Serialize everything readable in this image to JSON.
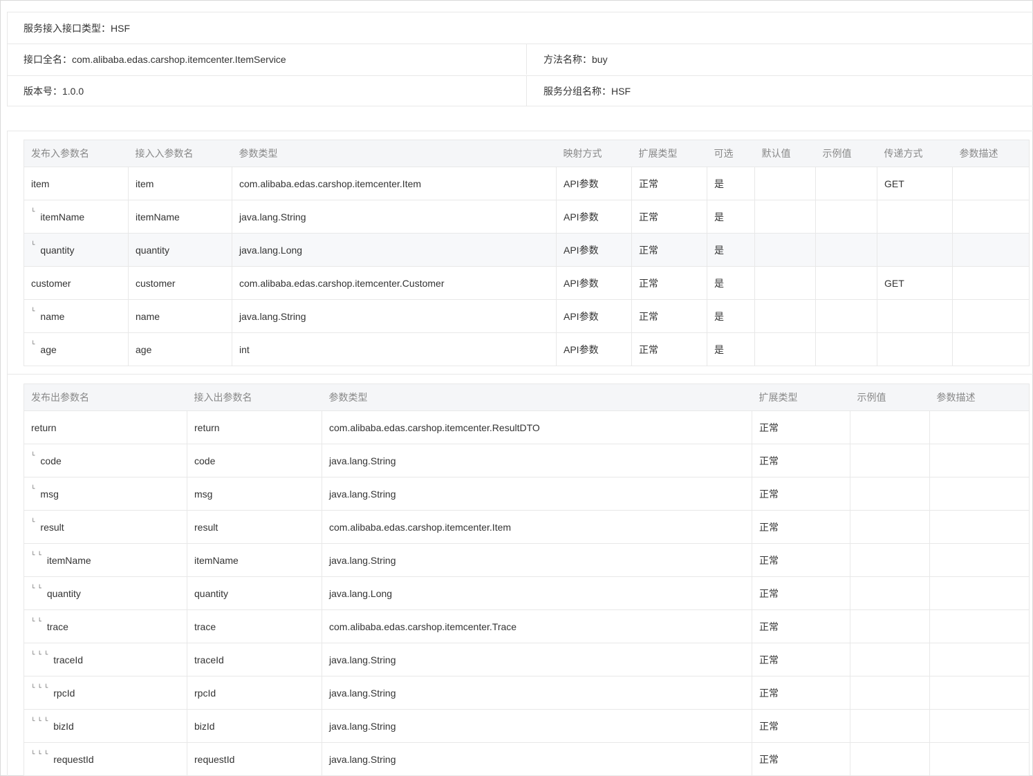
{
  "info": {
    "interface_type_label": "服务接入接口类型：",
    "interface_type_value": "HSF",
    "interface_name_label": "接口全名：",
    "interface_name_value": "com.alibaba.edas.carshop.itemcenter.ItemService",
    "method_label": "方法名称：",
    "method_value": "buy",
    "version_label": "版本号：",
    "version_value": "1.0.0",
    "group_label": "服务分组名称：",
    "group_value": "HSF"
  },
  "input_table": {
    "headers": [
      "发布入参数名",
      "接入入参数名",
      "参数类型",
      "映射方式",
      "扩展类型",
      "可选",
      "默认值",
      "示例值",
      "传递方式",
      "参数描述"
    ],
    "rows": [
      {
        "tree": "",
        "publish": "item",
        "access": "item",
        "type": "com.alibaba.edas.carshop.itemcenter.Item",
        "mapping": "API参数",
        "ext": "正常",
        "optional": "是",
        "default": "",
        "example": "",
        "transfer": "GET",
        "desc": ""
      },
      {
        "tree": "└",
        "publish": "itemName",
        "access": "itemName",
        "type": "java.lang.String",
        "mapping": "API参数",
        "ext": "正常",
        "optional": "是",
        "default": "",
        "example": "",
        "transfer": "",
        "desc": ""
      },
      {
        "tree": "└",
        "publish": "quantity",
        "access": "quantity",
        "type": "java.lang.Long",
        "mapping": "API参数",
        "ext": "正常",
        "optional": "是",
        "default": "",
        "example": "",
        "transfer": "",
        "desc": ""
      },
      {
        "tree": "",
        "publish": "customer",
        "access": "customer",
        "type": "com.alibaba.edas.carshop.itemcenter.Customer",
        "mapping": "API参数",
        "ext": "正常",
        "optional": "是",
        "default": "",
        "example": "",
        "transfer": "GET",
        "desc": ""
      },
      {
        "tree": "└",
        "publish": "name",
        "access": "name",
        "type": "java.lang.String",
        "mapping": "API参数",
        "ext": "正常",
        "optional": "是",
        "default": "",
        "example": "",
        "transfer": "",
        "desc": ""
      },
      {
        "tree": "└",
        "publish": "age",
        "access": "age",
        "type": "int",
        "mapping": "API参数",
        "ext": "正常",
        "optional": "是",
        "default": "",
        "example": "",
        "transfer": "",
        "desc": ""
      }
    ]
  },
  "output_table": {
    "headers": [
      "发布出参数名",
      "接入出参数名",
      "参数类型",
      "扩展类型",
      "示例值",
      "参数描述"
    ],
    "rows": [
      {
        "tree": "",
        "publish": "return",
        "access": "return",
        "type": "com.alibaba.edas.carshop.itemcenter.ResultDTO",
        "ext": "正常",
        "example": "",
        "desc": ""
      },
      {
        "tree": "└",
        "publish": "code",
        "access": "code",
        "type": "java.lang.String",
        "ext": "正常",
        "example": "",
        "desc": ""
      },
      {
        "tree": "└",
        "publish": "msg",
        "access": "msg",
        "type": "java.lang.String",
        "ext": "正常",
        "example": "",
        "desc": ""
      },
      {
        "tree": "└",
        "publish": "result",
        "access": "result",
        "type": "com.alibaba.edas.carshop.itemcenter.Item",
        "ext": "正常",
        "example": "",
        "desc": ""
      },
      {
        "tree": "└└",
        "publish": "itemName",
        "access": "itemName",
        "type": "java.lang.String",
        "ext": "正常",
        "example": "",
        "desc": ""
      },
      {
        "tree": "└└",
        "publish": "quantity",
        "access": "quantity",
        "type": "java.lang.Long",
        "ext": "正常",
        "example": "",
        "desc": ""
      },
      {
        "tree": "└└",
        "publish": "trace",
        "access": "trace",
        "type": "com.alibaba.edas.carshop.itemcenter.Trace",
        "ext": "正常",
        "example": "",
        "desc": ""
      },
      {
        "tree": "└└└",
        "publish": "traceId",
        "access": "traceId",
        "type": "java.lang.String",
        "ext": "正常",
        "example": "",
        "desc": ""
      },
      {
        "tree": "└└└",
        "publish": "rpcId",
        "access": "rpcId",
        "type": "java.lang.String",
        "ext": "正常",
        "example": "",
        "desc": ""
      },
      {
        "tree": "└└└",
        "publish": "bizId",
        "access": "bizId",
        "type": "java.lang.String",
        "ext": "正常",
        "example": "",
        "desc": ""
      },
      {
        "tree": "└└└",
        "publish": "requestId",
        "access": "requestId",
        "type": "java.lang.String",
        "ext": "正常",
        "example": "",
        "desc": ""
      }
    ]
  },
  "colors": {
    "border": "#e8e8e8",
    "header_bg": "#f5f6f8",
    "header_text": "#888888",
    "text": "#333333",
    "highlight_row": "#f7f8fa"
  }
}
